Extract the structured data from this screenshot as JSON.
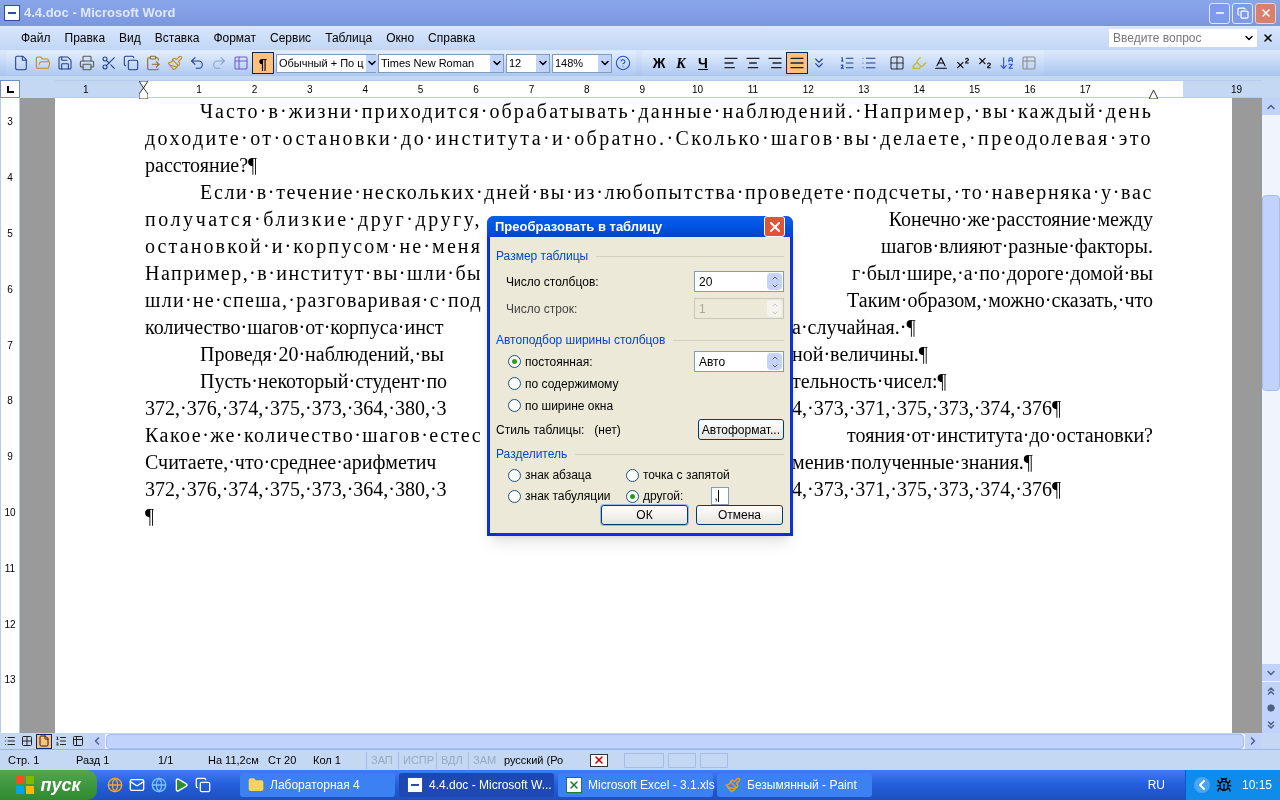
{
  "window": {
    "title": "4.4.doc - Microsoft Word"
  },
  "menu": [
    "Файл",
    "Правка",
    "Вид",
    "Вставка",
    "Формат",
    "Сервис",
    "Таблица",
    "Окно",
    "Справка"
  ],
  "help_search": {
    "placeholder": "Введите вопрос"
  },
  "toolbar": {
    "show_marks": {
      "label": "¶",
      "selected": true
    },
    "style": "Обычный + По ц",
    "font": "Times New Roman",
    "size": "12",
    "zoom": "148%",
    "bold": "Ж",
    "italic": "К",
    "underline": "Ч",
    "alignment": [
      {
        "kind": "left",
        "selected": false
      },
      {
        "kind": "center",
        "selected": false
      },
      {
        "kind": "right",
        "selected": false
      },
      {
        "kind": "justify",
        "selected": true
      }
    ]
  },
  "ruler": {
    "left_numbers": [
      "1"
    ],
    "numbers": [
      "1",
      "2",
      "3",
      "4",
      "5",
      "6",
      "7",
      "8",
      "9",
      "10",
      "11",
      "12",
      "13",
      "14",
      "15",
      "16",
      "17"
    ],
    "right_numbers": [
      "19"
    ]
  },
  "vertical_ruler": [
    "3",
    "4",
    "5",
    "6",
    "7",
    "8",
    "9",
    "10",
    "11",
    "12",
    "13"
  ],
  "document": {
    "lines": [
      {
        "indent": true,
        "justified": true,
        "left": "Часто·в·жизни·приходится·обрабатывать·данные·наблюдений.·Например,·вы·каждый·день"
      },
      {
        "indent": false,
        "justified": true,
        "left": "доходите·от·остановки·до·института·и·обратно.·Сколько·шагов·вы·делаете,·преодолевая·это"
      },
      {
        "indent": false,
        "justified": false,
        "left": "расстояние?¶"
      },
      {
        "indent": true,
        "justified": true,
        "left": "Если·в·течение·нескольких·дней·вы·из·любопытства·проведете·подсчеты,·то·наверняка·у·вас"
      },
      {
        "indent": false,
        "justified": true,
        "left": "получатся·близкие·друг·другу,",
        "right": "Конечно·же·расстояние·между"
      },
      {
        "indent": false,
        "justified": true,
        "left": "остановкой·и·корпусом·не·меня",
        "right": "шагов·влияют·разные·факторы."
      },
      {
        "indent": false,
        "justified": true,
        "left": "Например,·в·институт·вы·шли·бы",
        "right": "г·был·шире,·а·по·дороге·домой·вы"
      },
      {
        "indent": false,
        "justified": true,
        "left": "шли·не·спеша,·разговаривая·с·под",
        "right": "Таким·образом,·можно·сказать,·что"
      },
      {
        "indent": false,
        "justified": false,
        "left": "количество·шагов·от·корпуса·инст",
        "right": "а·случайная.·¶"
      },
      {
        "indent": true,
        "justified": false,
        "left": "Проведя·20·наблюдений,·вы",
        "right": "ной·величины.¶"
      },
      {
        "indent": true,
        "justified": false,
        "left": "Пусть·некоторый·студент·по",
        "right": "тельность·чисел:¶"
      },
      {
        "indent": false,
        "justified": false,
        "left": "372,·376,·374,·375,·373,·364,·380,·3",
        "right": "4,·373,·371,·375,·373,·374,·376¶"
      },
      {
        "indent": false,
        "justified": true,
        "left": "Какое·же·количество·шагов·естес",
        "right": "тояния·от·института·до·остановки?"
      },
      {
        "indent": false,
        "justified": false,
        "left": "Считаете,·что·среднее·арифметич",
        "right": "менив·полученные·знания.¶"
      },
      {
        "indent": false,
        "justified": false,
        "left": "372,·376,·374,·375,·373,·364,·380,·3",
        "right": "4,·373,·371,·375,·373,·374,·376¶"
      },
      {
        "indent": false,
        "left": "¶"
      }
    ]
  },
  "dialog": {
    "title": "Преобразовать в таблицу",
    "size_group": "Размер таблицы",
    "fields": [
      {
        "label": "Число столбцов:",
        "value": "20",
        "disabled": false
      },
      {
        "label": "Число строк:",
        "value": "1",
        "disabled": true
      }
    ],
    "autofit_group": "Автоподбор ширины столбцов",
    "autofit_options": [
      {
        "label": "постоянная:",
        "selected": true
      },
      {
        "label": "по содержимому",
        "selected": false
      },
      {
        "label": "по ширине окна",
        "selected": false
      }
    ],
    "fixed_width": "Авто",
    "style_label": "Стиль таблицы:",
    "style_value": "(нет)",
    "autoformat": "Автоформат...",
    "separator_group": "Разделитель",
    "separators": [
      {
        "label": "знак абзаца",
        "selected": false
      },
      {
        "label": "точка с запятой",
        "selected": false
      },
      {
        "label": "знак табуляции",
        "selected": false
      },
      {
        "label": "другой:",
        "selected": true
      }
    ],
    "other_value": ",",
    "buttons": [
      "ОК",
      "Отмена"
    ]
  },
  "status_bar": [
    {
      "text": "Стр. 1",
      "disabled": false
    },
    {
      "text": "Разд 1",
      "disabled": false
    },
    {
      "text": "1/1",
      "disabled": false
    },
    {
      "text": "На 11,2см",
      "disabled": false
    },
    {
      "text": "Ст 20",
      "disabled": false
    },
    {
      "text": "Кол 1",
      "disabled": false
    },
    {
      "text": "ЗАП",
      "disabled": true
    },
    {
      "text": "ИСПР",
      "disabled": true
    },
    {
      "text": "ВДЛ",
      "disabled": true
    },
    {
      "text": "ЗАМ",
      "disabled": true
    },
    {
      "text": "русский (Ро",
      "disabled": false
    }
  ],
  "taskbar": {
    "start": "пуск",
    "tasks": [
      {
        "kind": "folder",
        "label": "Лабораторная 4",
        "selected": false
      },
      {
        "kind": "word",
        "label": "4.4.doc - Microsoft W...",
        "selected": true
      },
      {
        "kind": "excel",
        "label": "Microsoft Excel - 3.1.xls",
        "selected": false
      },
      {
        "kind": "paint",
        "label": "Безымянный - Paint",
        "selected": false
      }
    ],
    "language": "RU",
    "time": "10:15"
  }
}
